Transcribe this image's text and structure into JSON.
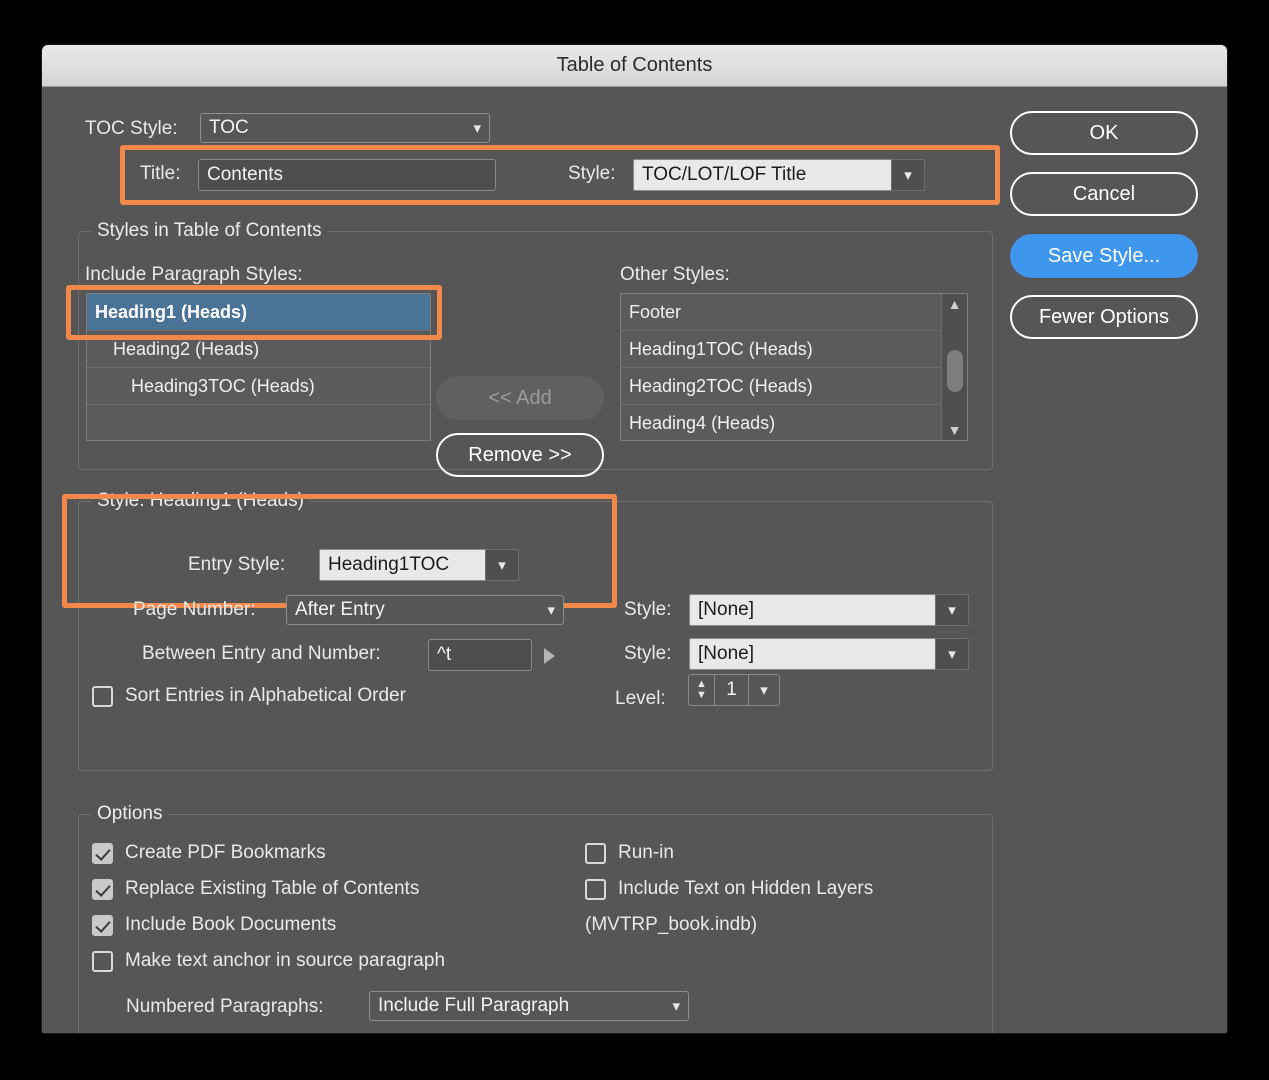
{
  "window": {
    "title": "Table of Contents"
  },
  "toc_style": {
    "label": "TOC Style:",
    "value": "TOC"
  },
  "title_row": {
    "title_label": "Title:",
    "title_value": "Contents",
    "style_label": "Style:",
    "style_value": "TOC/LOT/LOF Title"
  },
  "styles_group": {
    "legend": "Styles in Table of Contents",
    "include_label": "Include Paragraph Styles:",
    "other_label": "Other Styles:",
    "include_items": [
      {
        "label": "Heading1 (Heads)",
        "indent": 0,
        "selected": true
      },
      {
        "label": "Heading2 (Heads)",
        "indent": 1,
        "selected": false
      },
      {
        "label": "Heading3TOC (Heads)",
        "indent": 2,
        "selected": false
      },
      {
        "label": "",
        "indent": 0,
        "selected": false
      }
    ],
    "other_items": [
      {
        "label": "Footer"
      },
      {
        "label": "Heading1TOC (Heads)"
      },
      {
        "label": "Heading2TOC (Heads)"
      },
      {
        "label": "Heading4 (Heads)"
      }
    ],
    "add_button": "<< Add",
    "remove_button": "Remove >>"
  },
  "style_group": {
    "legend": "Style: Heading1 (Heads)",
    "entry_style_label": "Entry Style:",
    "entry_style_value": "Heading1TOC",
    "page_number_label": "Page Number:",
    "page_number_value": "After Entry",
    "page_number_style_label": "Style:",
    "page_number_style_value": "[None]",
    "between_label": "Between Entry and Number:",
    "between_value": "^t",
    "between_style_label": "Style:",
    "between_style_value": "[None]",
    "sort_label": "Sort Entries in Alphabetical Order",
    "sort_checked": false,
    "level_label": "Level:",
    "level_value": "1"
  },
  "options_group": {
    "legend": "Options",
    "left_items": [
      {
        "label": "Create PDF Bookmarks",
        "checked": true
      },
      {
        "label": "Replace Existing Table of Contents",
        "checked": true
      },
      {
        "label": "Include Book Documents",
        "checked": true
      },
      {
        "label": "Make text anchor in source paragraph",
        "checked": false
      }
    ],
    "right_items": [
      {
        "label": "Run-in",
        "checked": false
      },
      {
        "label": "Include Text on Hidden Layers",
        "checked": false
      }
    ],
    "book_name": "(MVTRP_book.indb)",
    "numbered_label": "Numbered Paragraphs:",
    "numbered_value": "Include Full Paragraph"
  },
  "buttons": {
    "ok": "OK",
    "cancel": "Cancel",
    "save_style": "Save Style...",
    "fewer_options": "Fewer Options"
  },
  "colors": {
    "highlight": "#f3884b",
    "accent": "#3f96ed",
    "selection": "#4b7396",
    "dialog_bg": "#565656"
  }
}
